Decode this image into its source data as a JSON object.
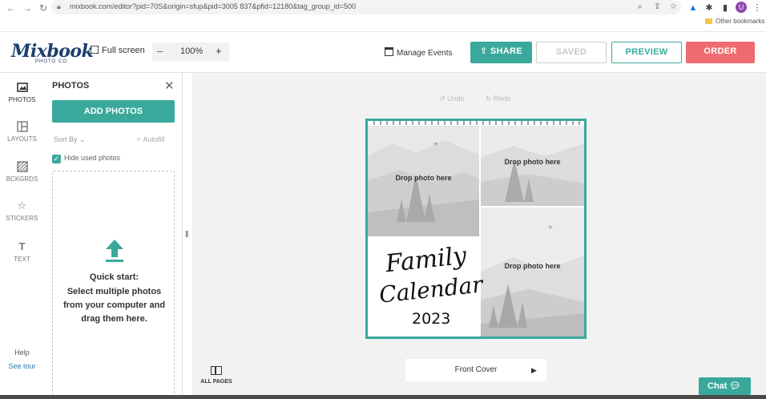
{
  "browser": {
    "url": "mixbook.com/editor?pid=70S&origin=sfup&pid=3005 837&pfid=12180&tag_group_id=500",
    "bookmarks_label": "Other bookmarks",
    "profile_initial": "U"
  },
  "header": {
    "logo": "Mixbook",
    "logo_sub": "PHOTO CO.",
    "full_screen": "Full screen",
    "zoom_minus": "–",
    "zoom_value": "100%",
    "zoom_plus": "+",
    "manage_events": "Manage Events",
    "share": "SHARE",
    "saved": "SAVED",
    "preview": "PREVIEW",
    "order": "ORDER"
  },
  "rail": {
    "items": [
      {
        "label": "PHOTOS",
        "icon": "image-icon"
      },
      {
        "label": "LAYOUTS",
        "icon": "layout-icon"
      },
      {
        "label": "BCKGRDS",
        "icon": "background-icon"
      },
      {
        "label": "STICKERS",
        "icon": "star-icon"
      },
      {
        "label": "TEXT",
        "icon": "text-icon"
      }
    ],
    "help": "Help",
    "see_tour": "See tour"
  },
  "panel": {
    "title": "PHOTOS",
    "add_photos": "ADD PHOTOS",
    "sort_by": "Sort By",
    "autofill": "Autofill",
    "hide_used": "Hide used photos",
    "quick_start_title": "Quick start:",
    "quick_start_body": "Select multiple photos from your computer and drag them here."
  },
  "canvas": {
    "undo": "Undo",
    "redo": "Redo",
    "drop_label": "Drop photo here",
    "title_line1": "Family",
    "title_line2": "Calendar",
    "year": "2023",
    "page_name": "Front Cover",
    "all_pages": "ALL PAGES"
  },
  "chat": {
    "label": "Chat"
  },
  "colors": {
    "accent": "#3aa99b",
    "order": "#ee6c6f",
    "brand": "#1c3f6e"
  }
}
